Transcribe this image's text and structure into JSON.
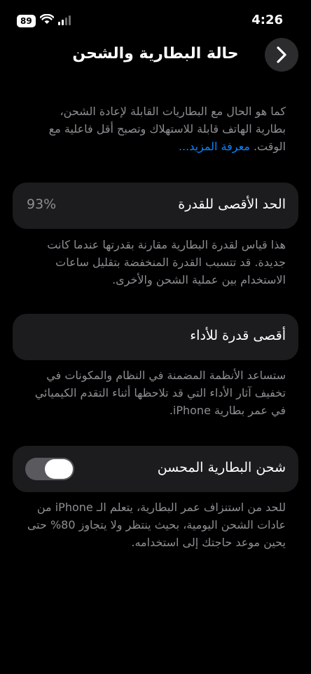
{
  "status_bar": {
    "battery_level": "89",
    "time": "4:26",
    "icons": [
      "wifi-icon",
      "signal-icon"
    ]
  },
  "nav": {
    "title": "حالة البطارية والشحن",
    "back_icon": "chevron-right-icon"
  },
  "intro": {
    "text": "كما هو الحال مع البطاريات القابلة لإعادة الشحن، بطارية الهاتف قابلة للاستهلاك وتصبح أقل فاعلية مع الوقت.",
    "link": "معرفة المزيد..."
  },
  "max_capacity": {
    "label": "الحد الأقصى للقدرة",
    "value": "93%",
    "description": "هذا قياس لقدرة البطارية مقارنة بقدرتها عندما كانت جديدة. قد تتسبب القدرة المنخفضة بتقليل ساعات الاستخدام بين عملية الشحن والأخرى."
  },
  "peak_performance": {
    "label": "أقصى قدرة للأداء",
    "description": "ستساعد الأنظمة المضمنة في النظام والمكونات في تخفيف آثار الأداء التي قد تلاحظها أثناء التقدم الكيميائي في عمر بطارية iPhone."
  },
  "optimized_charging": {
    "label": "شحن البطارية المحسن",
    "enabled": true,
    "description": "للحد من استنزاف عمر البطارية، يتعلم الـ iPhone من عادات الشحن اليومية، بحيث ينتظر ولا يتجاوز 80% حتى يحين موعد حاجتك إلى استخدامه."
  }
}
